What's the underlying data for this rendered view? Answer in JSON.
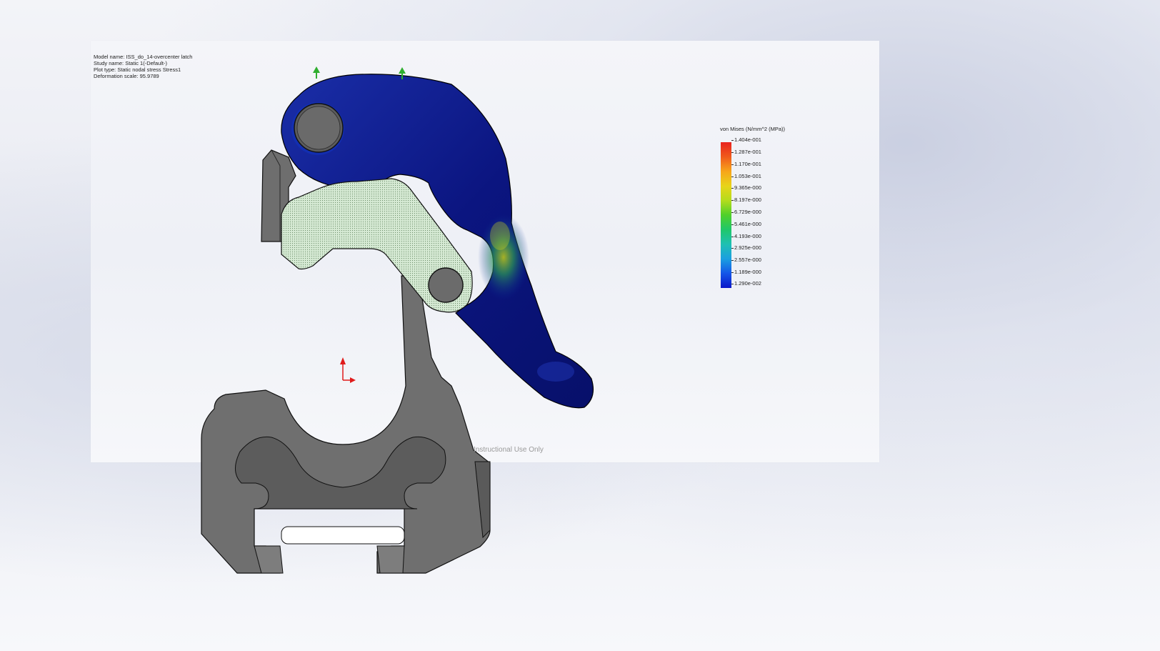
{
  "study_info": {
    "model_name": "Model name: ISS_do_14-overcenter latch",
    "study_name": "Study name: Static 1(-Default-)",
    "plot_type": "Plot type: Static nodal stress Stress1",
    "deformation_scale": "Deformation scale: 95.9789"
  },
  "legend": {
    "title": "von Mises (N/mm^2 (MPa))",
    "ticks": [
      "1.404e-001",
      "1.287e-001",
      "1.170e-001",
      "1.053e-001",
      "9.365e-000",
      "8.197e-000",
      "6.729e-000",
      "5.461e-000",
      "4.193e-000",
      "2.925e-000",
      "2.557e-000",
      "1.189e-000",
      "1.290e-002"
    ]
  },
  "watermark": "Instructional Use Only",
  "colors": {
    "latch_arm": "#08137a",
    "linkage": "#cfe5cc",
    "base_body": "#6b6b6b",
    "fixture_arrow": "#2fae2f",
    "axis_arrow": "#e01b1b"
  },
  "icons": {
    "fixture_markers": "green-fixture-arrow-icon",
    "triad": "axis-triad-icon"
  }
}
